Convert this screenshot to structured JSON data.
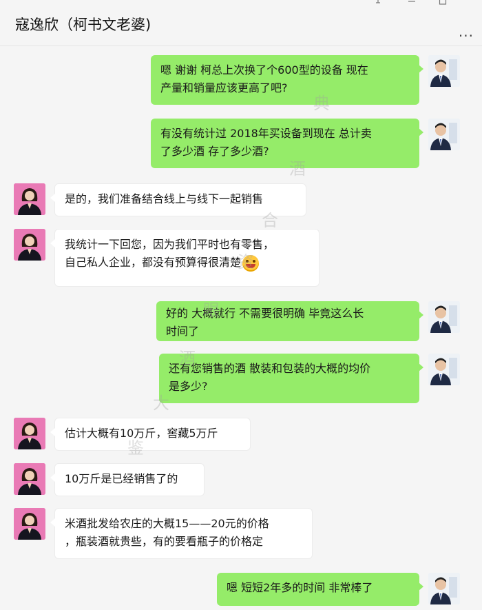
{
  "header": {
    "title": "寇逸欣（柯书文老婆)",
    "more_label": "...",
    "pin_icon": "pin-icon",
    "min_icon": "minimize-icon",
    "max_icon": "maximize-icon"
  },
  "colors": {
    "sent_bubble": "#95ec69",
    "received_bubble": "#ffffff",
    "background": "#f5f5f5",
    "female_avatar_bg": "#e97ab5"
  },
  "messages": [
    {
      "side": "right",
      "lines": [
        "嗯  谢谢  柯总上次换了个600型的设备  现在",
        "产量和销量应该更高了吧?"
      ]
    },
    {
      "side": "right",
      "lines": [
        "有没有统计过  2018年买设备到现在   总计卖",
        "了多少酒   存了多少酒?"
      ]
    },
    {
      "side": "left",
      "lines": [
        "是的，我们准备结合线上与线下一起销售"
      ]
    },
    {
      "side": "left",
      "lines": [
        "我统计一下回您，因为我们平时也有零售，",
        "自己私人企业，都没有预算得很清楚"
      ]
    },
    {
      "side": "right",
      "lines": [
        "好的   大概就行   不需要很明确   毕竟这么长",
        "时间了"
      ]
    },
    {
      "side": "right",
      "lines": [
        "还有您销售的酒   散装和包装的大概的均价",
        "是多少?"
      ]
    },
    {
      "side": "left",
      "lines": [
        "估计大概有10万斤，窖藏5万斤"
      ]
    },
    {
      "side": "left",
      "lines": [
        "10万斤是已经销售了的"
      ]
    },
    {
      "side": "left",
      "lines": [
        "米酒批发给农庄的大概15——20元的价格",
        "，瓶装酒就贵些，有的要看瓶子的价格定"
      ]
    },
    {
      "side": "right",
      "lines": [
        "嗯    短短2年多的时间   非常棒了"
      ]
    }
  ],
  "watermark": [
    "典",
    "酒",
    "合",
    "资",
    "大",
    "眼",
    "酒",
    "鉴"
  ]
}
